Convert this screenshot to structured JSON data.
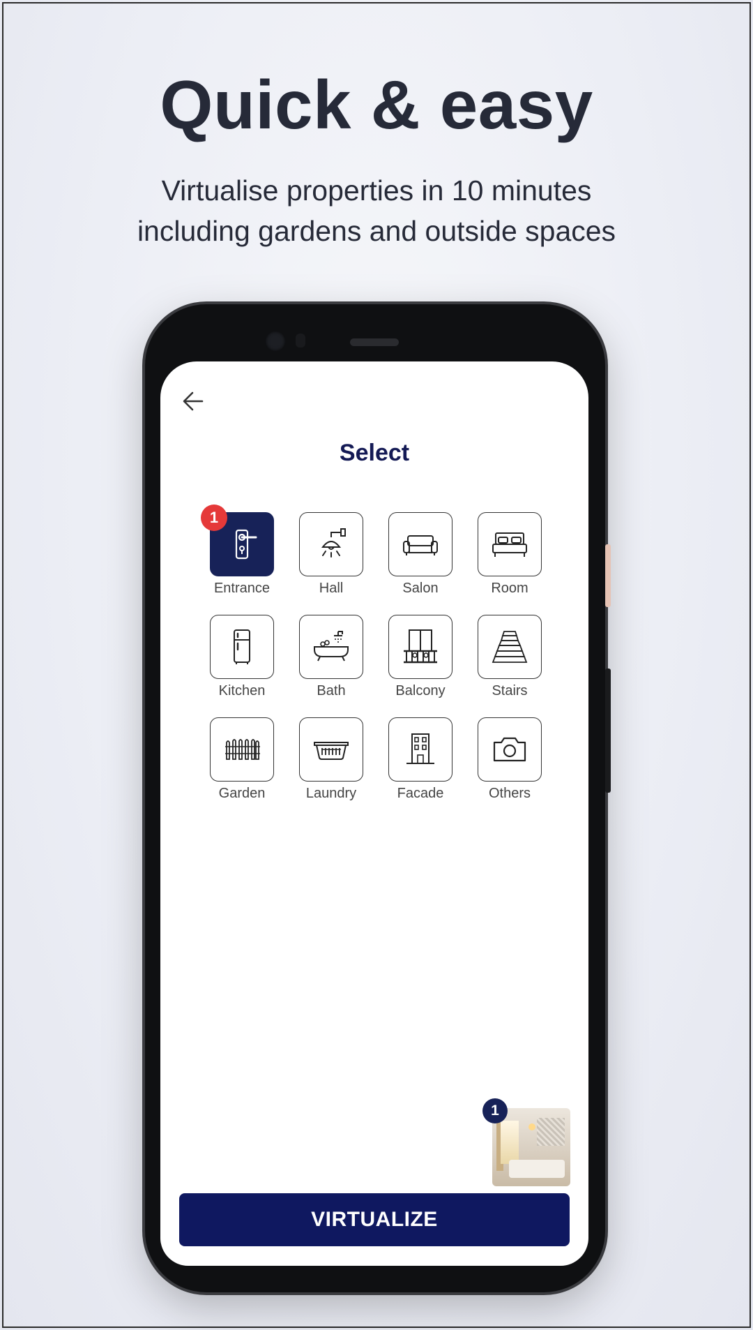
{
  "promo": {
    "headline": "Quick & easy",
    "subline_1": "Virtualise properties in 10 minutes",
    "subline_2": "including gardens and outside spaces"
  },
  "screen": {
    "title": "Select",
    "back_icon": "arrow-left-icon",
    "categories": [
      {
        "label": "Entrance",
        "icon": "door-handle-icon",
        "selected": true,
        "count": "1"
      },
      {
        "label": "Hall",
        "icon": "ceiling-lamp-icon",
        "selected": false
      },
      {
        "label": "Salon",
        "icon": "sofa-icon",
        "selected": false
      },
      {
        "label": "Room",
        "icon": "bed-icon",
        "selected": false
      },
      {
        "label": "Kitchen",
        "icon": "fridge-icon",
        "selected": false
      },
      {
        "label": "Bath",
        "icon": "bathtub-icon",
        "selected": false
      },
      {
        "label": "Balcony",
        "icon": "balcony-icon",
        "selected": false
      },
      {
        "label": "Stairs",
        "icon": "stairs-icon",
        "selected": false
      },
      {
        "label": "Garden",
        "icon": "fence-icon",
        "selected": false
      },
      {
        "label": "Laundry",
        "icon": "laundry-basket-icon",
        "selected": false
      },
      {
        "label": "Facade",
        "icon": "building-icon",
        "selected": false
      },
      {
        "label": "Others",
        "icon": "camera-icon",
        "selected": false
      }
    ],
    "thumbnail": {
      "count": "1"
    },
    "virtualize_label": "VIRTUALIZE"
  },
  "colors": {
    "accent_navy": "#0f1860",
    "badge_red": "#e53939",
    "title_text": "#141a55"
  }
}
